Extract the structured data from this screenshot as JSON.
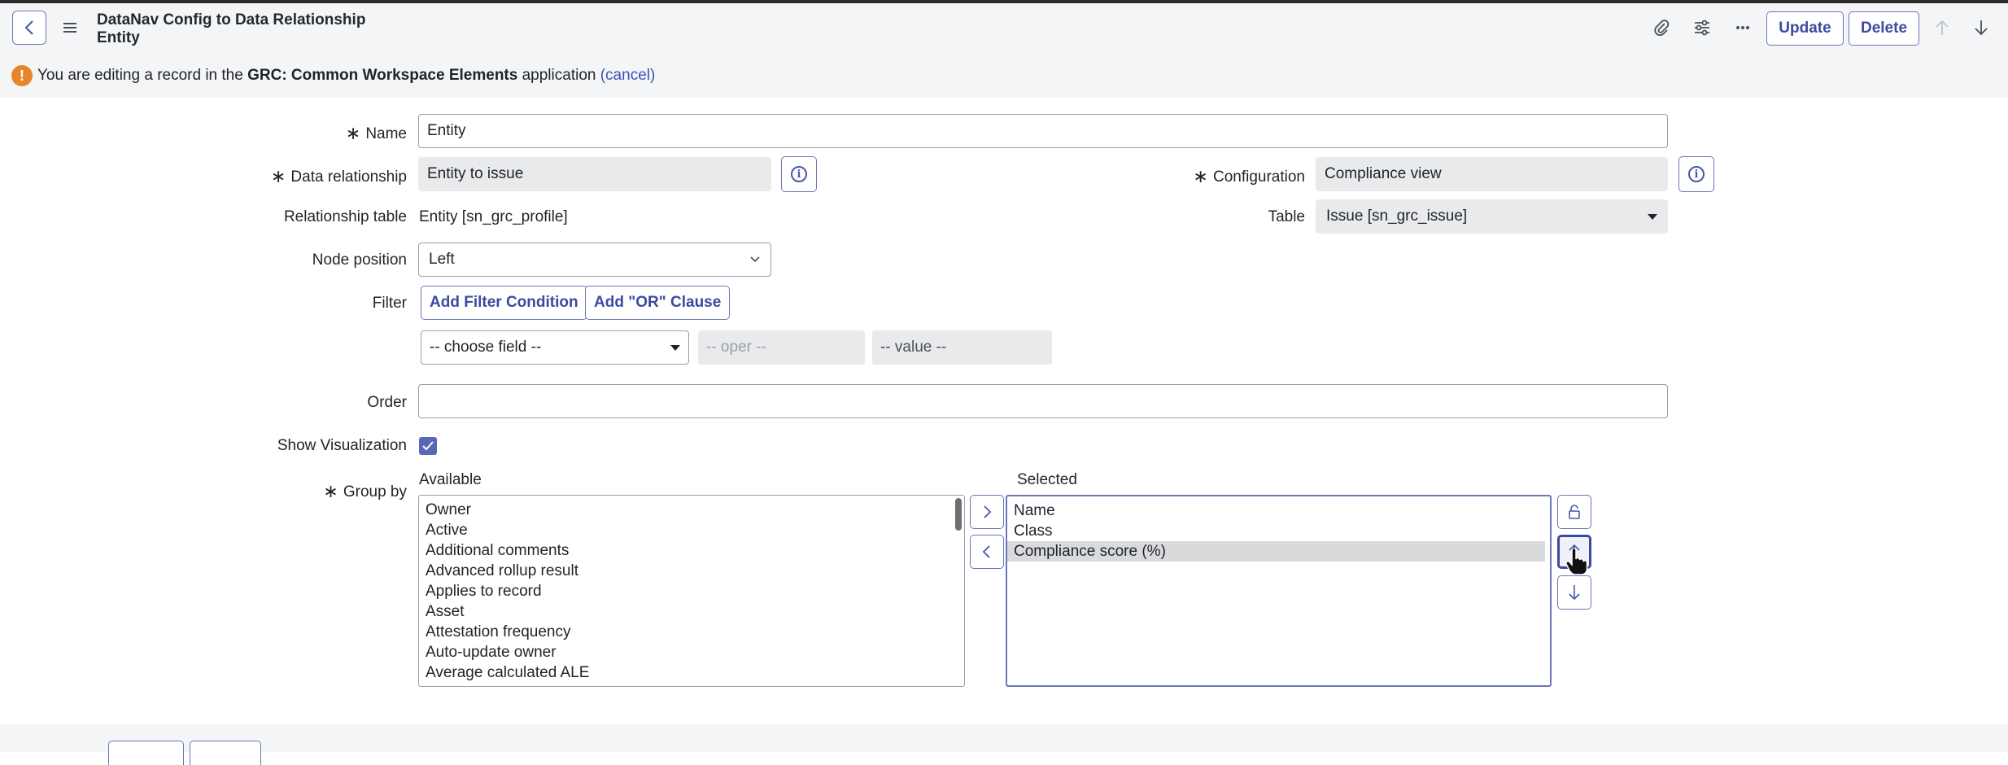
{
  "header": {
    "title_line1": "DataNav Config to Data Relationship",
    "title_line2": "Entity",
    "update_label": "Update",
    "delete_label": "Delete"
  },
  "notice": {
    "prefix": "You are editing a record in the",
    "app_name": "GRC: Common Workspace Elements",
    "suffix": "application",
    "cancel_link": "(cancel)"
  },
  "form": {
    "name_label": "Name",
    "name_value": "Entity",
    "data_relationship_label": "Data relationship",
    "data_relationship_value": "Entity to issue",
    "configuration_label": "Configuration",
    "configuration_value": "Compliance view",
    "relationship_table_label": "Relationship table",
    "relationship_table_value": "Entity [sn_grc_profile]",
    "table_label": "Table",
    "table_value": "Issue [sn_grc_issue]",
    "node_position_label": "Node position",
    "node_position_value": "Left",
    "filter_label": "Filter",
    "add_filter_condition": "Add Filter Condition",
    "add_or_clause": "Add \"OR\" Clause",
    "choose_field": "-- choose field --",
    "oper": "-- oper --",
    "value": "-- value --",
    "order_label": "Order",
    "order_value": "",
    "show_visualization_label": "Show Visualization",
    "show_visualization_checked": true,
    "group_by_label": "Group by",
    "available_label": "Available",
    "selected_label": "Selected",
    "available_items": [
      "Owner",
      "Active",
      "Additional comments",
      "Advanced rollup result",
      "Applies to record",
      "Asset",
      "Attestation frequency",
      "Auto-update owner",
      "Average calculated ALE"
    ],
    "selected_items": [
      "Name",
      "Class",
      "Compliance score (%)"
    ],
    "selected_highlight": "Compliance score (%)"
  },
  "colors": {
    "accent": "#3b4aa0",
    "warning": "#e8852b",
    "checkbox": "#5a66b8"
  }
}
